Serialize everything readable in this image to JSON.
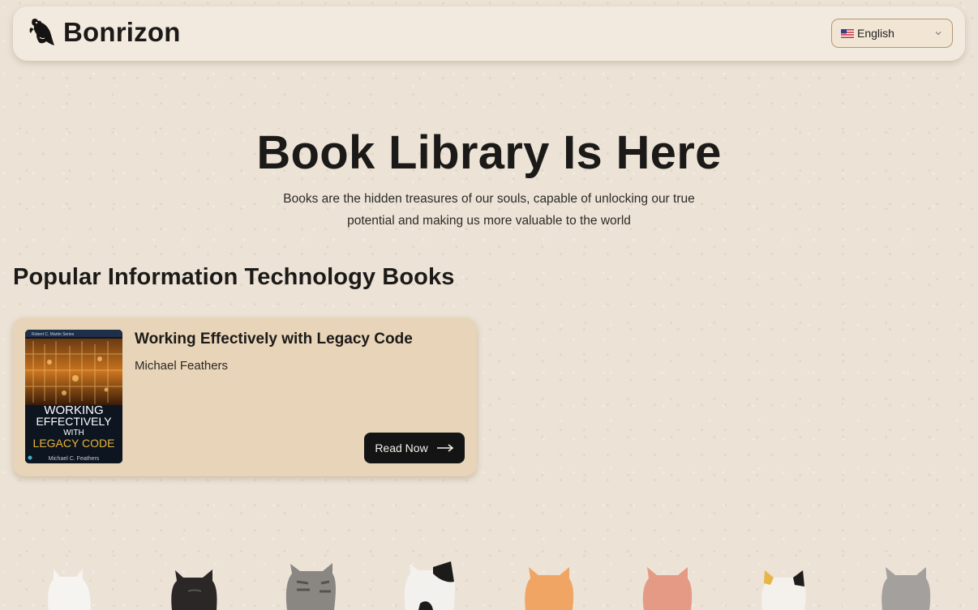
{
  "brand": {
    "name": "Bonrizon",
    "logo_icon": "bird-logo-icon"
  },
  "language_select": {
    "value": "English",
    "flag_icon": "us-flag-icon",
    "chevron_icon": "chevron-down-icon"
  },
  "hero": {
    "title": "Book Library Is Here",
    "subtitle_line1": "Books are the hidden treasures of our souls, capable of unlocking our true",
    "subtitle_line2": "potential and making us more valuable to the world"
  },
  "section": {
    "title": "Popular Information Technology Books"
  },
  "books": [
    {
      "title": "Working Effectively with Legacy Code",
      "author": "Michael Feathers",
      "button_label": "Read Now",
      "cover": {
        "series": "Robert C. Martin Series",
        "line1": "WORKING",
        "line2": "EFFECTIVELY",
        "line3": "WITH",
        "line4": "LEGACY CODE",
        "author": "Michael C. Feathers"
      }
    }
  ],
  "decor": {
    "cats": [
      "white-cat-icon",
      "black-cat-icon",
      "gray-tabby-cat-icon",
      "black-white-cat-icon",
      "orange-cat-icon",
      "pink-cat-icon",
      "calico-cat-icon",
      "gray-cat-icon"
    ]
  },
  "colors": {
    "background": "#ece3d6",
    "header": "#f3eadf",
    "card": "#e8d4b8",
    "button": "#141414",
    "accent_gold": "#e8b33a"
  }
}
